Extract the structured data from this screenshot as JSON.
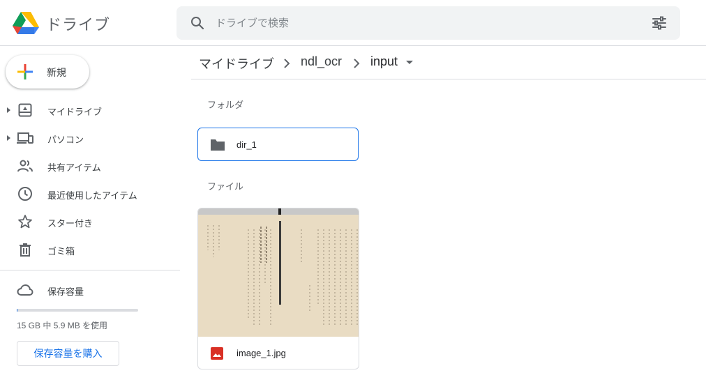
{
  "app": {
    "title": "ドライブ",
    "logo_icon": "google-drive-logo"
  },
  "search": {
    "placeholder": "ドライブで検索",
    "icon": "search-icon",
    "options_icon": "tune-icon"
  },
  "sidebar": {
    "new_button_label": "新規",
    "items": [
      {
        "label": "マイドライブ",
        "icon": "my-drive-icon",
        "expandable": true
      },
      {
        "label": "パソコン",
        "icon": "computers-icon",
        "expandable": true
      },
      {
        "label": "共有アイテム",
        "icon": "shared-icon",
        "expandable": false
      },
      {
        "label": "最近使用したアイテム",
        "icon": "clock-icon",
        "expandable": false
      },
      {
        "label": "スター付き",
        "icon": "star-icon",
        "expandable": false
      },
      {
        "label": "ゴミ箱",
        "icon": "trash-icon",
        "expandable": false
      }
    ],
    "storage": {
      "label": "保存容量",
      "icon": "cloud-icon",
      "usage_text": "15 GB 中 5.9 MB を使用",
      "used_fraction": 0.0004,
      "buy_button_label": "保存容量を購入"
    }
  },
  "breadcrumb": {
    "items": [
      "マイドライブ",
      "ndl_ocr",
      "input"
    ]
  },
  "main": {
    "folders_title": "フォルダ",
    "folders": [
      {
        "name": "dir_1",
        "icon": "folder-icon"
      }
    ],
    "files_title": "ファイル",
    "files": [
      {
        "name": "image_1.jpg",
        "icon": "image-file-icon"
      }
    ]
  },
  "colors": {
    "accent": "#1a73e8",
    "text": "#3c4043",
    "divider": "#dadce0",
    "search_bg": "#f1f3f4",
    "image_icon": "#d93025"
  }
}
